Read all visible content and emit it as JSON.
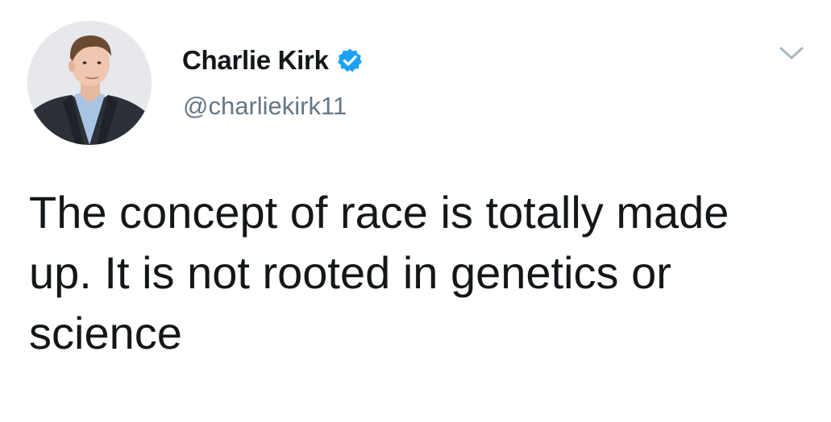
{
  "tweet": {
    "author": {
      "display_name": "Charlie Kirk",
      "handle": "@charliekirk11",
      "verified": true,
      "avatar_icon": "profile-photo"
    },
    "text": "The concept of race is totally made up. It is not rooted in genetics or science",
    "menu_icon": "chevron-down-icon"
  },
  "colors": {
    "text_primary": "#14171a",
    "text_secondary": "#657786",
    "verified_blue": "#1da1f2",
    "caret_gray": "#aab8c2"
  }
}
